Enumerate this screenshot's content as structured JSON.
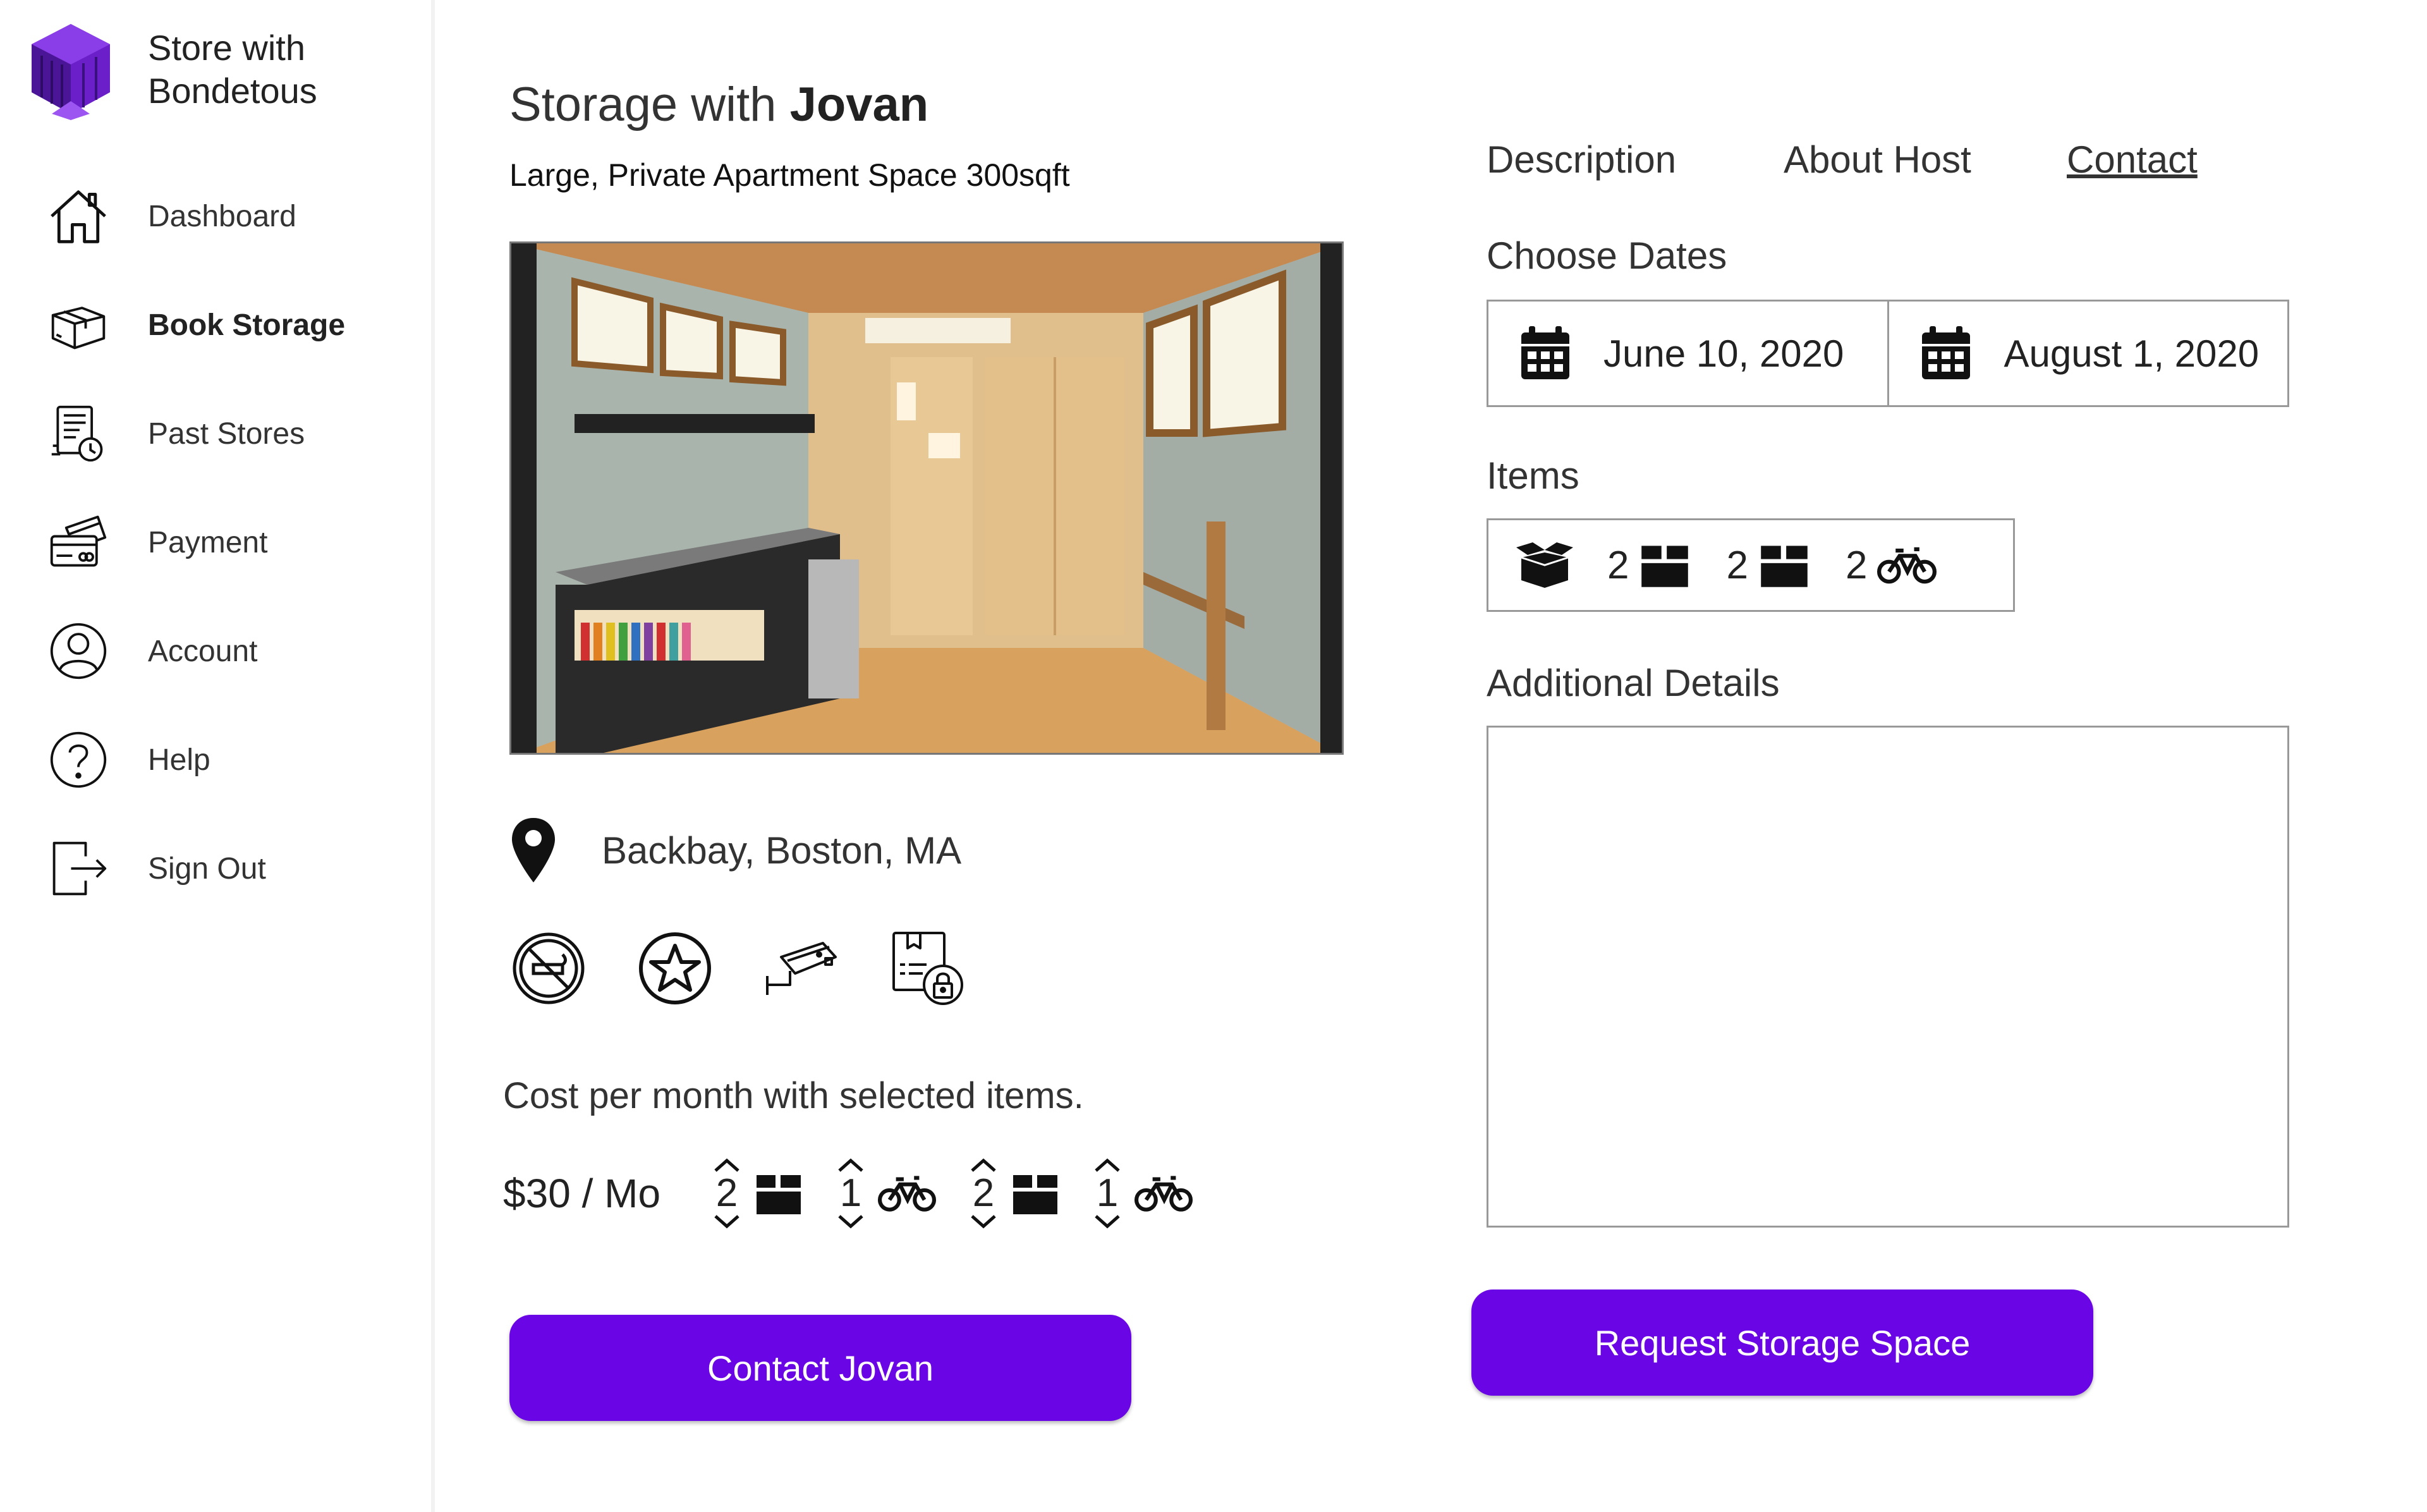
{
  "brand": {
    "name_line1": "Store with",
    "name_line2": "Bondetous",
    "logo_icon": "purple-box-logo-icon"
  },
  "sidebar": {
    "items": [
      {
        "label": "Dashboard",
        "icon": "home-icon",
        "active": false
      },
      {
        "label": "Book Storage",
        "icon": "box-icon",
        "active": true
      },
      {
        "label": "Past Stores",
        "icon": "receipt-clock-icon",
        "active": false
      },
      {
        "label": "Payment",
        "icon": "credit-card-icon",
        "active": false
      },
      {
        "label": "Account",
        "icon": "user-circle-icon",
        "active": false
      },
      {
        "label": "Help",
        "icon": "question-circle-icon",
        "active": false
      },
      {
        "label": "Sign Out",
        "icon": "sign-out-icon",
        "active": false
      }
    ]
  },
  "listing": {
    "title_prefix": "Storage with ",
    "host_name": "Jovan",
    "subtitle": "Large, Private Apartment Space 300sqft",
    "location": "Backbay, Boston, MA",
    "amenities": [
      "no-smoking-icon",
      "star-badge-icon",
      "security-camera-icon",
      "locked-document-icon"
    ],
    "cost_label": "Cost per month with selected items.",
    "price": "$30 / Mo",
    "steppers": [
      {
        "value": "2",
        "icon": "box-icon"
      },
      {
        "value": "1",
        "icon": "bike-icon"
      },
      {
        "value": "2",
        "icon": "box-icon"
      },
      {
        "value": "1",
        "icon": "bike-icon"
      }
    ],
    "contact_button": "Contact Jovan"
  },
  "tabs": [
    {
      "label": "Description",
      "underlined": false
    },
    {
      "label": "About Host",
      "underlined": false
    },
    {
      "label": "Contact",
      "underlined": true
    }
  ],
  "booking": {
    "dates_label": "Choose Dates",
    "start_date": "June 10, 2020",
    "end_date": "August 1, 2020",
    "items_label": "Items",
    "items": [
      {
        "count": "2",
        "icon": "box-icon"
      },
      {
        "count": "2",
        "icon": "box-icon"
      },
      {
        "count": "2",
        "icon": "bike-icon"
      }
    ],
    "details_label": "Additional Details",
    "request_button": "Request Storage Space"
  },
  "colors": {
    "accent": "#6a06e6",
    "logo_purple": "#5b1bb0"
  }
}
